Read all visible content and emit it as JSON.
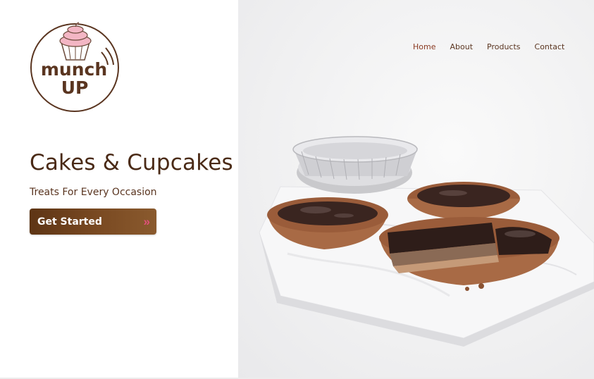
{
  "brand": {
    "logo_line1": "munch",
    "logo_line2": "UP"
  },
  "nav": {
    "items": [
      {
        "label": "Home"
      },
      {
        "label": "About"
      },
      {
        "label": "Products"
      },
      {
        "label": "Contact"
      }
    ]
  },
  "hero": {
    "title": "Cakes & Cupcakes",
    "subtitle": "Treats For Every Occasion",
    "cta_label": "Get Started",
    "cta_icon": "double-chevron-right-icon",
    "image_subject": "chocolate tarts on marble board"
  },
  "colors": {
    "brand_brown": "#4a2a16",
    "button_brown": "#6b3f1d",
    "accent_pink": "#e0507a",
    "frosting_pink": "#f3b6c4"
  }
}
